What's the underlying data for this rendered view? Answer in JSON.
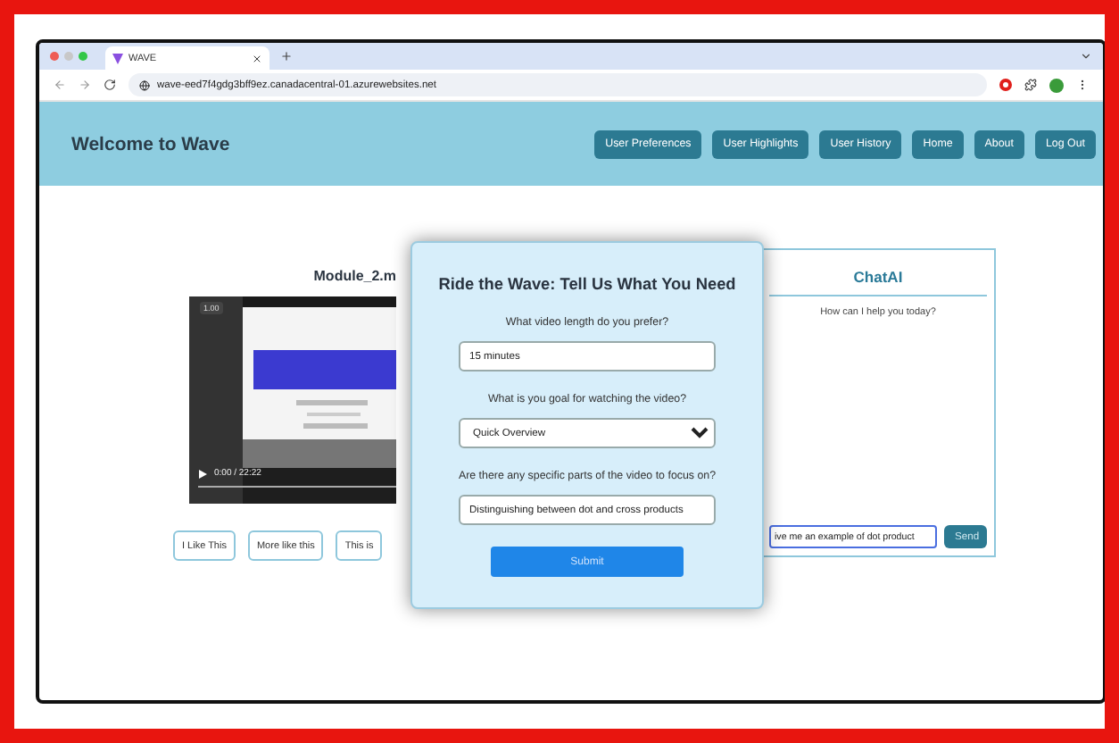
{
  "browser": {
    "tab_title": "WAVE",
    "url": "wave-eed7f4gdg3bff9ez.canadacentral-01.azurewebsites.net"
  },
  "header": {
    "title": "Welcome to Wave",
    "nav": [
      "User Preferences",
      "User Highlights",
      "User History",
      "Home",
      "About",
      "Log Out"
    ]
  },
  "video": {
    "title": "Module_2.m",
    "speed": "1.00",
    "time": "0:00 / 22:22"
  },
  "feedback_buttons": [
    "I Like This",
    "More like this",
    "This is"
  ],
  "modal": {
    "title": "Ride the Wave: Tell Us What You Need",
    "fields": [
      {
        "kind": "text",
        "label": "What video length do you prefer?",
        "value": "15 minutes"
      },
      {
        "kind": "select",
        "label": "What is you goal for watching the video?",
        "value": "Quick Overview"
      },
      {
        "kind": "text",
        "label": "Are there any specific parts of the video to focus on?",
        "value": "Distinguishing between dot and cross products"
      }
    ],
    "submit": "Submit"
  },
  "chat": {
    "title": "ChatAI",
    "greeting": "How can I help you today?",
    "input": "ive me an example of dot product",
    "send": "Send"
  }
}
